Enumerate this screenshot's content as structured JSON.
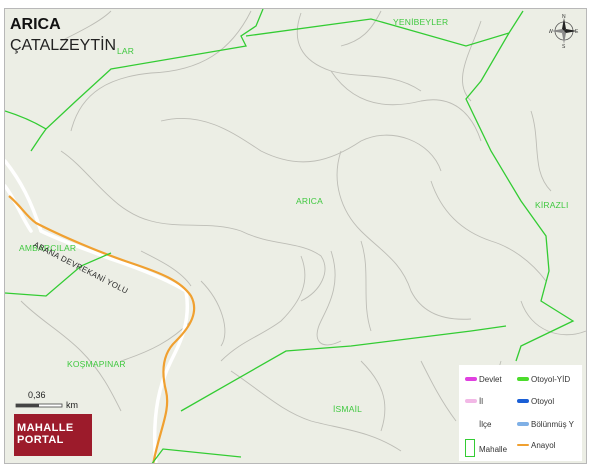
{
  "header": {
    "title": "ARICA",
    "subtitle": "ÇATALZEYTİN"
  },
  "places": {
    "yenibeyler": "YENİBEYLER",
    "arica": "ARICA",
    "kirazli": "KİRAZLI",
    "ambarcilar": "AMBARCILAR",
    "kosmapinar": "KOŞMAPINAR",
    "ismail": "İSMAİL",
    "partial_top": "LAR"
  },
  "road": {
    "name": "ABANA DEVREKANİ YOLU"
  },
  "scale": {
    "value": "0,36",
    "unit": "km"
  },
  "compass": {
    "icon": "north-arrow-compass",
    "n": "N",
    "s": "S",
    "w": "W",
    "e": "E"
  },
  "logo": {
    "line1": "MAHALLE",
    "line2": "PORTAL"
  },
  "legend": {
    "col1": [
      {
        "label": "Devlet",
        "color": "#e040e0"
      },
      {
        "label": "İl",
        "color": "#f2b8e6"
      },
      {
        "label": "İlçe",
        "color": ""
      },
      {
        "label": "Mahalle",
        "color": "#33cc33"
      }
    ],
    "col2": [
      {
        "label": "Otoyol-YİD",
        "color": "#4cdc2c"
      },
      {
        "label": "Otoyol",
        "color": "#1a5fd6"
      },
      {
        "label": "Bölünmüş Y",
        "color": "#7fb0e6"
      },
      {
        "label": "Anayol",
        "color": "#f0a030"
      }
    ]
  },
  "colors": {
    "boundary": "#33cc33",
    "anayol": "#f0a030",
    "road": "#ffffff",
    "contour": "#bdbdb6",
    "background": "#eceee5"
  }
}
